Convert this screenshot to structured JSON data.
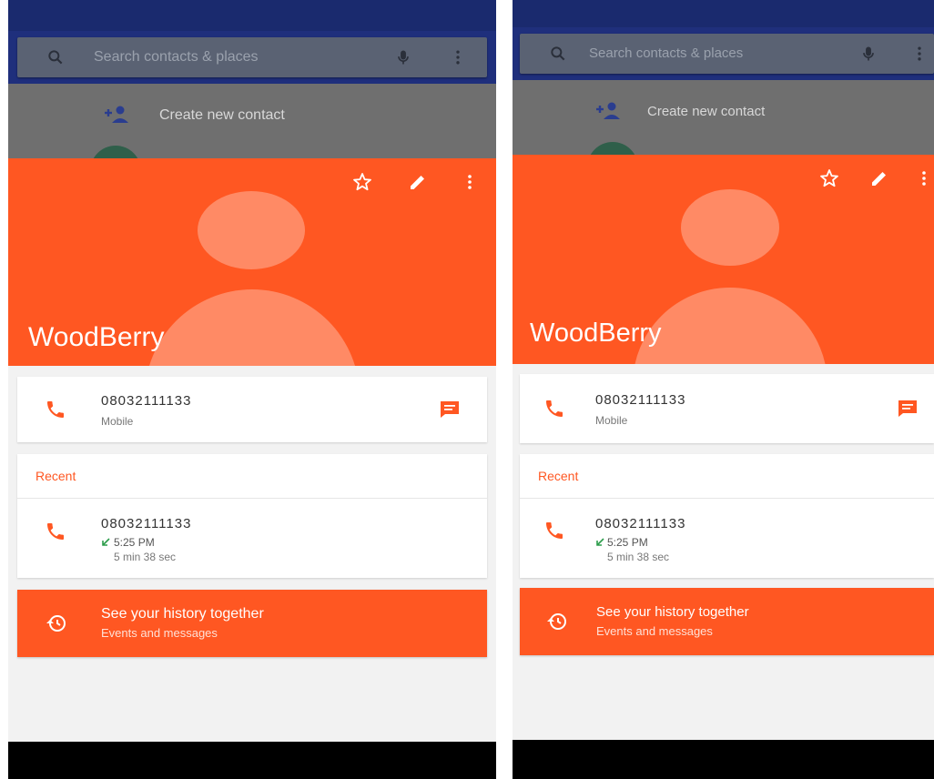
{
  "screens": [
    {
      "search": {
        "placeholder": "Search contacts & places"
      },
      "create_contact": {
        "label": "Create new contact"
      },
      "contact": {
        "name": "WoodBerry"
      },
      "phone": {
        "number": "08032111133",
        "type": "Mobile"
      },
      "recent": {
        "header": "Recent",
        "number": "08032111133",
        "time": "5:25 PM",
        "duration": "5 min 38 sec"
      },
      "history": {
        "title": "See your history together",
        "subtitle": "Events and messages"
      }
    },
    {
      "search": {
        "placeholder": "Search contacts & places"
      },
      "create_contact": {
        "label": "Create new contact"
      },
      "contact": {
        "name": "WoodBerry"
      },
      "phone": {
        "number": "08032111133",
        "type": "Mobile"
      },
      "recent": {
        "header": "Recent",
        "number": "08032111133",
        "time": "5:25 PM",
        "duration": "5 min 38 sec"
      },
      "history": {
        "title": "See your history together",
        "subtitle": "Events and messages"
      }
    }
  ],
  "icons": [
    "search-icon",
    "mic-icon",
    "more-vert-icon",
    "add-person-icon",
    "star-icon",
    "edit-icon",
    "phone-icon",
    "message-icon",
    "call-received-icon",
    "history-icon"
  ],
  "colors": {
    "accent": "#ff5722",
    "avatar_placeholder": "#ff8a65",
    "status_bar": "#1a2a6e",
    "search_dim": "#5a6273",
    "incoming_call": "#2e9d4c"
  }
}
